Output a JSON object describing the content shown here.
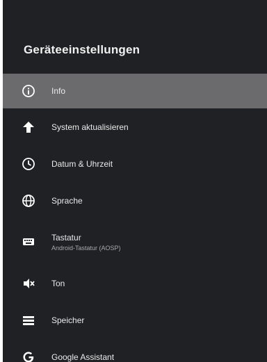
{
  "screen": {
    "title": "Geräteeinstellungen"
  },
  "menu": [
    {
      "label": "Info",
      "icon": "info-icon",
      "selected": true
    },
    {
      "label": "System aktualisieren",
      "icon": "arrow-up-icon"
    },
    {
      "label": "Datum & Uhrzeit",
      "icon": "clock-icon"
    },
    {
      "label": "Sprache",
      "icon": "globe-icon"
    },
    {
      "label": "Tastatur",
      "subtitle": "Android-Tastatur (AOSP)",
      "icon": "keyboard-icon"
    },
    {
      "label": "Ton",
      "icon": "volume-off-icon"
    },
    {
      "label": "Speicher",
      "icon": "storage-icon"
    },
    {
      "label": "Google Assistant",
      "icon": "google-icon"
    }
  ],
  "colors": {
    "background": "#202124",
    "selected": "#6b6b6d",
    "text": "#eaeaea"
  }
}
